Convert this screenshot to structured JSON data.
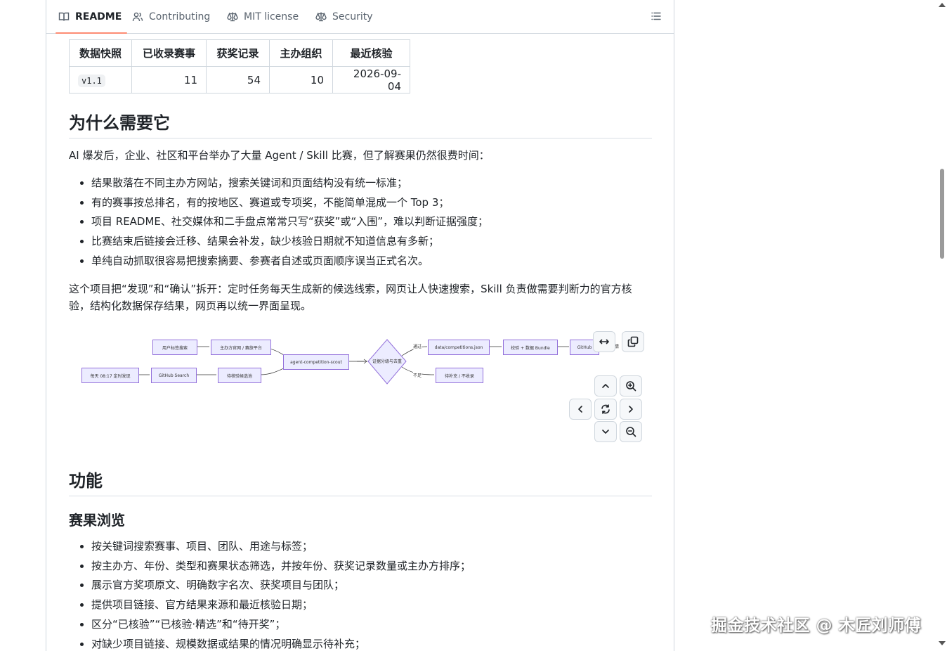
{
  "tabs": [
    {
      "label": "README",
      "icon": "book-icon",
      "active": true
    },
    {
      "label": "Contributing",
      "icon": "people-icon"
    },
    {
      "label": "MIT license",
      "icon": "law-icon"
    },
    {
      "label": "Security",
      "icon": "law-icon"
    }
  ],
  "snapshot_table": {
    "headers": [
      "数据快照",
      "已收录赛事",
      "获奖记录",
      "主办组织",
      "最近核验"
    ],
    "row": {
      "version": "v1.1",
      "events": "11",
      "awards": "54",
      "orgs": "10",
      "verified": "2026-09-04"
    }
  },
  "why": {
    "heading": "为什么需要它",
    "intro": "AI 爆发后，企业、社区和平台举办了大量 Agent / Skill 比赛，但了解赛果仍然很费时间：",
    "bullets": [
      "结果散落在不同主办方网站，搜索关键词和页面结构没有统一标准；",
      "有的赛事按总排名，有的按地区、赛道或专项奖，不能简单混成一个 Top 3；",
      "项目 README、社交媒体和二手盘点常常只写“获奖”或“入围”，难以判断证据强度；",
      "比赛结束后链接会迁移、结果会补发，缺少核验日期就不知道信息有多新；",
      "单纯自动抓取很容易把搜索摘要、参赛者自述或页面顺序误当正式名次。"
    ],
    "summary": "这个项目把“发现”和“确认”拆开：定时任务每天生成新的候选线索，网页让人快速搜索，Skill 负责做需要判断力的官方核验，结构化数据保存结果，网页再以统一界面呈现。"
  },
  "diagram": {
    "nodes": {
      "n1": "用户标签搜索",
      "n2": "主办方官网 / 赛旅平台",
      "n3": "每天 08:17 定时发现",
      "n4": "GitHub Search",
      "n5": "待核验候选池",
      "n6": "agent-competition-scout",
      "n7": "证据分级与去重",
      "n8": "data/competitions.json",
      "n9": "校验 + 数据 Bundle",
      "n10": "GitHub",
      "n11": "待补充 / 不收录",
      "n12": "情"
    },
    "edge_labels": {
      "pass": "通过",
      "insufficient": "不足"
    }
  },
  "features": {
    "heading": "功能",
    "sub_heading": "赛果浏览",
    "bullets": [
      "按关键词搜索赛事、项目、团队、用途与标签；",
      "按主办方、年份、类型和赛果状态筛选，并按年份、获奖记录数量或主办方排序；",
      "展示官方奖项原文、明确数字名次、获奖项目与团队；",
      "提供项目链接、官方结果来源和最近核验日期；",
      "区分“已核验”“已核验·精选”和“待开奖”；",
      "对缺少项目链接、规模数据或结果的情况明确显示待补充；"
    ]
  },
  "watermark": "掘金技术社区 @ 木匠刘师傅"
}
